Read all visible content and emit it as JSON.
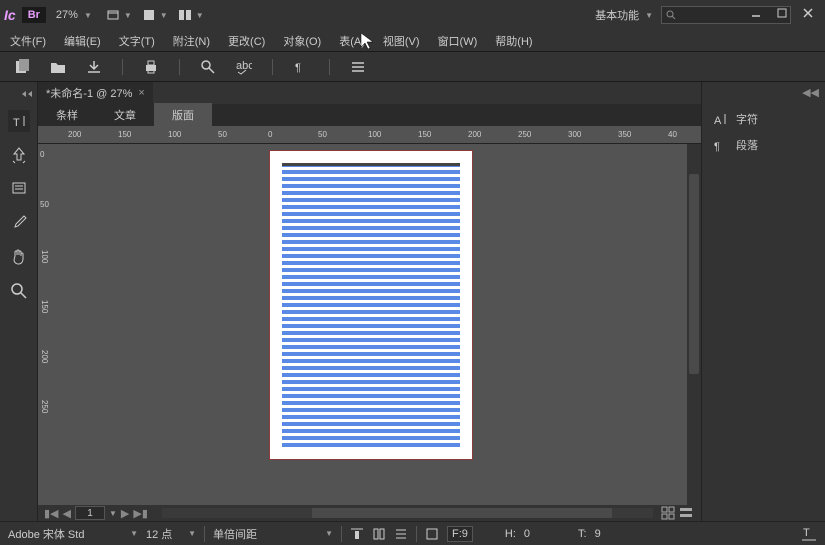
{
  "titlebar": {
    "app_abbrev": "Ic",
    "bridge_badge": "Br",
    "zoom": "27%",
    "workspace": "基本功能"
  },
  "menu": {
    "file": "文件(F)",
    "edit": "编辑(E)",
    "text": "文字(T)",
    "notes": "附注(N)",
    "changes": "更改(C)",
    "object": "对象(O)",
    "table": "表(A)",
    "view": "视图(V)",
    "window": "窗口(W)",
    "help": "帮助(H)"
  },
  "document": {
    "tab_title": "*未命名-1 @ 27%",
    "sub_tabs": {
      "story": "条样",
      "article": "文章",
      "layout": "版面"
    },
    "ruler_h": [
      "200",
      "150",
      "100",
      "50",
      "0",
      "50",
      "100",
      "150",
      "200",
      "250",
      "300",
      "350",
      "40"
    ],
    "ruler_v": [
      "0",
      "50",
      "100",
      "150",
      "200",
      "250"
    ],
    "page_number": "1"
  },
  "right_panel": {
    "character": "字符",
    "paragraph": "段落"
  },
  "status": {
    "font": "Adobe 宋体 Std",
    "font_size": "12 点",
    "leading": "单倍间距",
    "f_label": "F:",
    "f_val": "9",
    "h_label": "H:",
    "h_val": "0",
    "t_label": "T:",
    "t_val": "9"
  }
}
